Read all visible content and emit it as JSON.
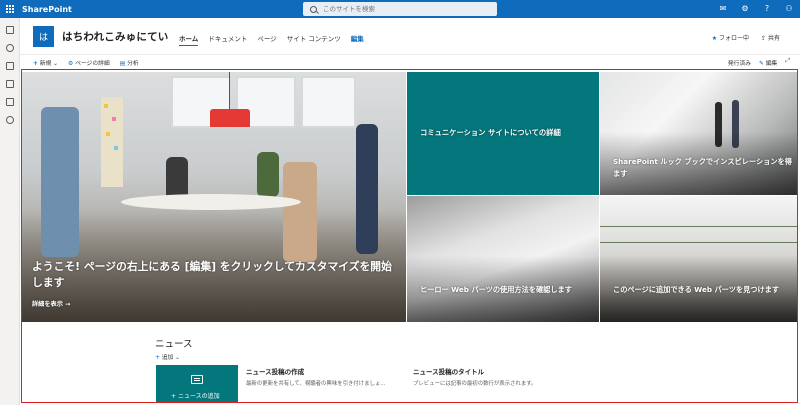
{
  "suitebar": {
    "app_name": "SharePoint",
    "search_placeholder": "このサイトを検索",
    "icons": [
      "waffle-icon",
      "feedback-icon",
      "settings-icon",
      "help-icon",
      "account-icon"
    ]
  },
  "rail": {
    "icons": [
      "home-icon",
      "globe-icon",
      "news-icon",
      "document-icon",
      "lists-icon",
      "add-icon"
    ]
  },
  "site": {
    "logo_letter": "は",
    "title": "はちわれこみゅにてい",
    "nav": [
      {
        "label": "ホーム",
        "active": true
      },
      {
        "label": "ドキュメント"
      },
      {
        "label": "ページ"
      },
      {
        "label": "サイト コンテンツ"
      },
      {
        "label": "編集"
      }
    ],
    "follow_label": "フォロー中",
    "share_label": "共有"
  },
  "commandbar": {
    "new_label": "新規",
    "page_details_label": "ページの詳細",
    "analytics_label": "分析",
    "published_label": "発行済み",
    "edit_label": "編集"
  },
  "hero": {
    "main_heading": "ようこそ! ページの右上にある [編集] をクリックしてカスタマイズを開始します",
    "main_link": "詳細を表示 →",
    "tile_teal": "コミュニケーション サイトについての詳細",
    "tile_top_right": "SharePoint ルック ブックでインスピレーションを得ます",
    "tile_bottom_middle": "ヒーロー Web パーツの使用方法を確認します",
    "tile_bottom_right": "このページに追加できる Web パーツを見つけます"
  },
  "news": {
    "title": "ニュース",
    "add_label": "追加",
    "add_news_label": "ニュースの追加",
    "posts": [
      {
        "title": "ニュース投稿の作成",
        "desc": "最新の更新を共有して、視聴者の興味を引き付けましょ..."
      },
      {
        "title": "ニュース投稿のタイトル",
        "desc": "プレビューには記事の最初の数行が表示されます。"
      }
    ]
  },
  "colors": {
    "suitebar": "#0f6cbd",
    "teal": "#04777c",
    "highlight": "#e02020"
  }
}
